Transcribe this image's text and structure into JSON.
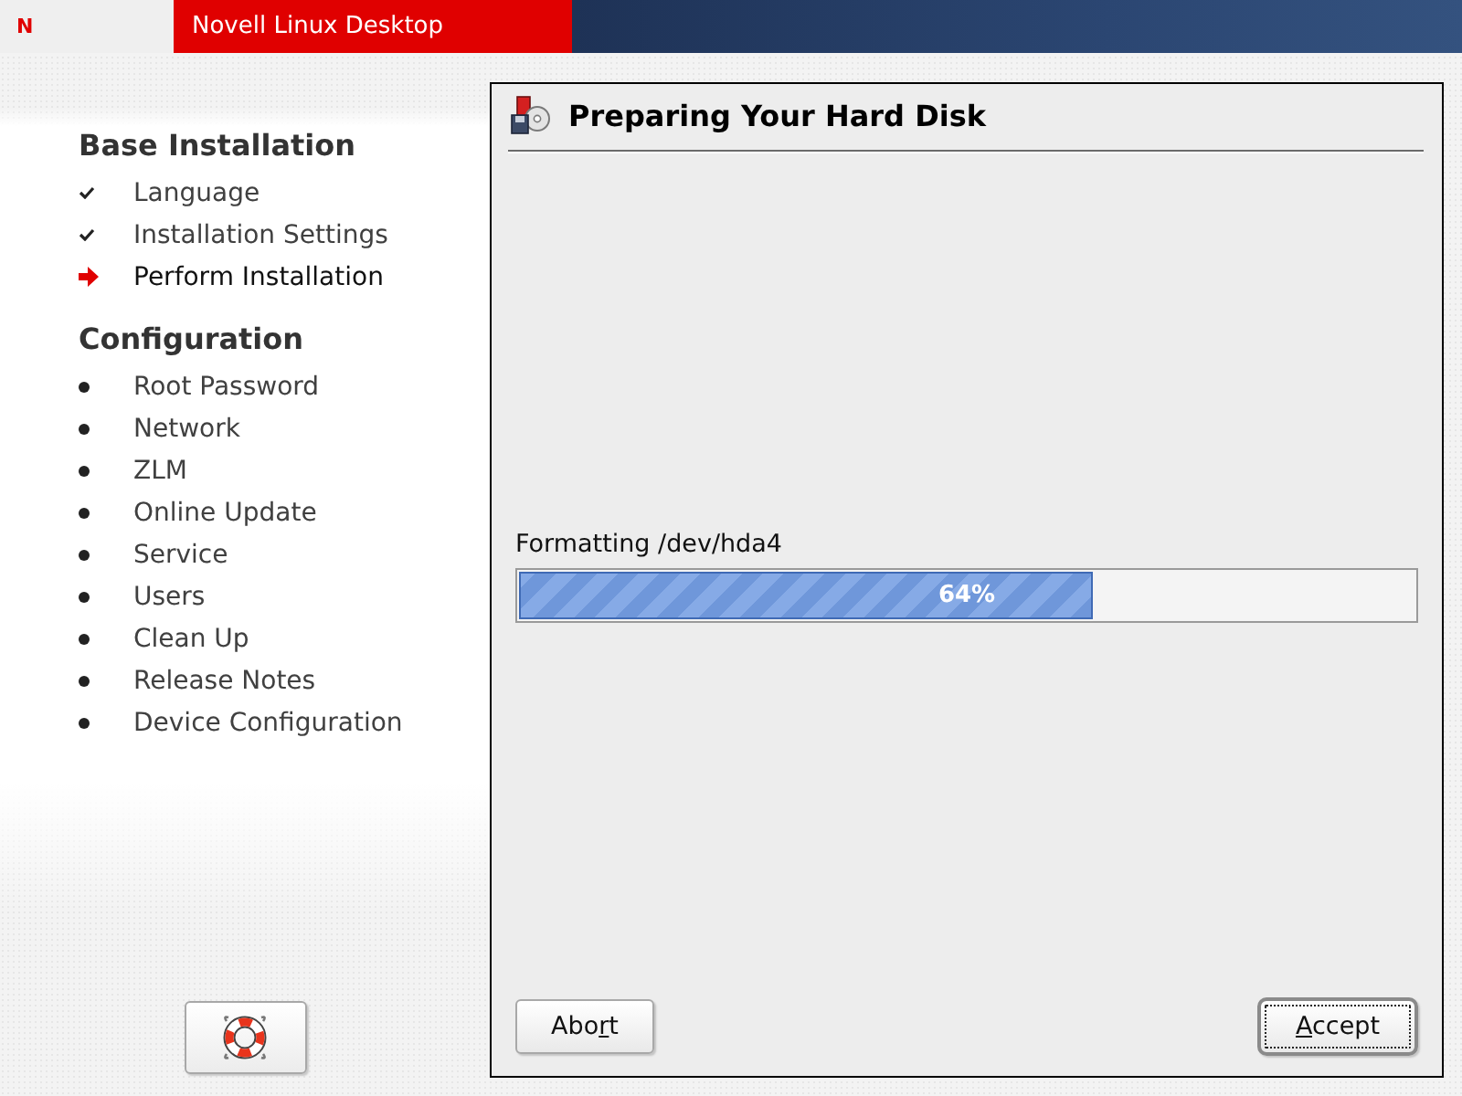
{
  "header": {
    "logo": "N",
    "title": "Novell Linux Desktop"
  },
  "sidebar": {
    "sections": [
      {
        "title": "Base Installation",
        "items": [
          {
            "label": "Language",
            "kind": "done"
          },
          {
            "label": "Installation Settings",
            "kind": "done"
          },
          {
            "label": "Perform Installation",
            "kind": "current"
          }
        ]
      },
      {
        "title": "Configuration",
        "items": [
          {
            "label": "Root Password",
            "kind": "todo"
          },
          {
            "label": "Network",
            "kind": "todo"
          },
          {
            "label": "ZLM",
            "kind": "todo"
          },
          {
            "label": "Online Update",
            "kind": "todo"
          },
          {
            "label": "Service",
            "kind": "todo"
          },
          {
            "label": "Users",
            "kind": "todo"
          },
          {
            "label": "Clean Up",
            "kind": "todo"
          },
          {
            "label": "Release Notes",
            "kind": "todo"
          },
          {
            "label": "Device Configuration",
            "kind": "todo"
          }
        ]
      }
    ]
  },
  "panel": {
    "title": "Preparing Your Hard Disk",
    "progress": {
      "label": "Formatting /dev/hda4",
      "level": 0.64,
      "reading": "64%"
    },
    "buttons": [
      {
        "label_start": "Abo",
        "access_key": "r",
        "label_end": "t",
        "default": false
      },
      {
        "access_key": "A",
        "label_end": "ccept",
        "default": true
      }
    ]
  }
}
